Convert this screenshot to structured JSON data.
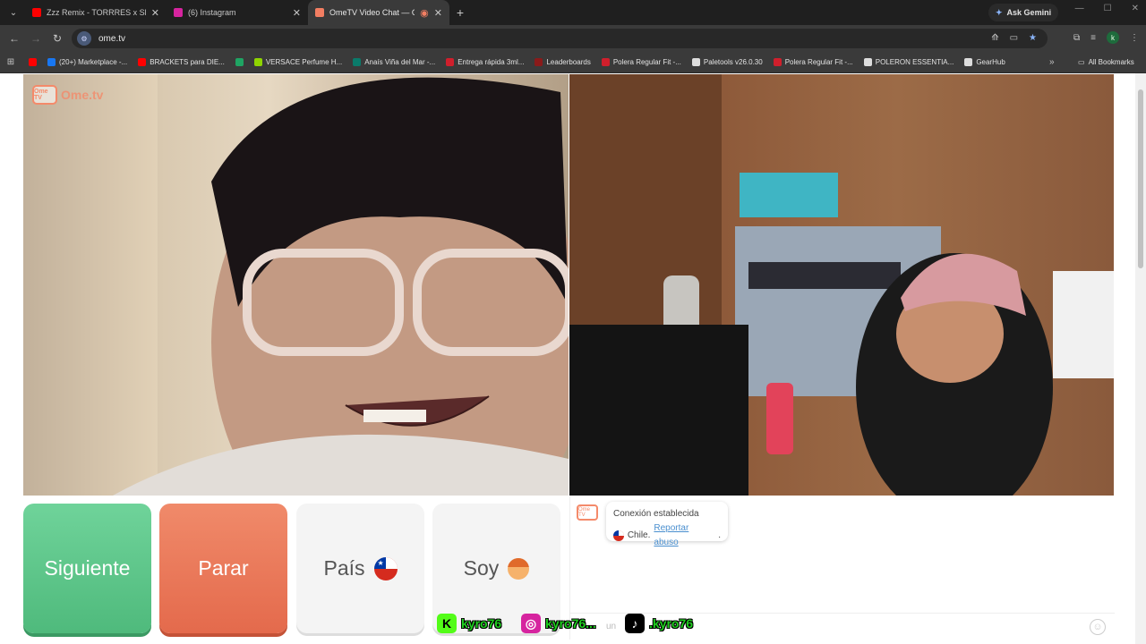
{
  "browser": {
    "tabs": [
      {
        "label": "Zzz Remix - TORRRES x Slayter",
        "color": "#ff0000"
      },
      {
        "label": "(6) Instagram",
        "color": "#d6249f"
      },
      {
        "label": "OmeTV Video Chat — Ome",
        "color": "#f27e62"
      }
    ],
    "ask_gemini": "Ask Gemini",
    "url": "ome.tv",
    "profile_initial": "k",
    "bookmarks": [
      {
        "label": "",
        "color": "#ff0000"
      },
      {
        "label": "(20+) Marketplace -...",
        "color": "#1877f2"
      },
      {
        "label": "BRACKETS para DIE...",
        "color": "#ff0000"
      },
      {
        "label": "",
        "color": "#1fa463"
      },
      {
        "label": "VERSACE Perfume H...",
        "color": "#8fd400"
      },
      {
        "label": "Anaís Viña del Mar -...",
        "color": "#0a7a6a"
      },
      {
        "label": "Entrega rápida 3ml...",
        "color": "#d01f2c"
      },
      {
        "label": "Leaderboards",
        "color": "#8a1a1a"
      },
      {
        "label": "Polera Regular Fit -...",
        "color": "#d01f2c"
      },
      {
        "label": "Paletools v26.0.30",
        "color": "#dddddd"
      },
      {
        "label": "Polera Regular Fit -...",
        "color": "#d01f2c"
      },
      {
        "label": "POLERON ESSENTIA...",
        "color": "#dddddd"
      },
      {
        "label": "GearHub",
        "color": "#dddddd"
      }
    ],
    "all_bookmarks": "All Bookmarks"
  },
  "logo": {
    "tv": "Ome TV",
    "text": "Ome.tv"
  },
  "buttons": {
    "next": "Siguiente",
    "stop": "Parar",
    "country": "País",
    "gender": "Soy"
  },
  "chat": {
    "tv": "Ome TV",
    "status": "Conexión establecida",
    "country": "Chile.",
    "report": "Reportar abuso",
    "report_suffix": ".",
    "input_placeholder": "un"
  },
  "social": [
    {
      "name": "kyro76",
      "icon": "kick-icon",
      "color": "#53fc18"
    },
    {
      "name": "kyro76...",
      "icon": "instagram-icon",
      "color": "#d6249f"
    },
    {
      "name": ".kyro76",
      "icon": "tiktok-icon",
      "color": "#000000"
    }
  ]
}
